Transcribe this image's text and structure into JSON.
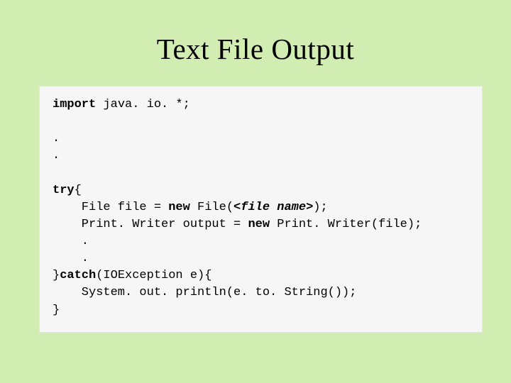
{
  "title": "Text File Output",
  "code": {
    "l1_a": "import",
    "l1_b": " java. io. *;",
    "d1": ".",
    "d2": ".",
    "try_kw": "try",
    "try_brace": "{",
    "l_file_a": "File file = ",
    "l_file_new": "new",
    "l_file_b": " File(",
    "l_file_arg": "<file name>",
    "l_file_c": ");",
    "l_pw_a": "Print. Writer output = ",
    "l_pw_new": "new",
    "l_pw_b": " Print. Writer(file);",
    "d3": ".",
    "d4": ".",
    "catch_close": "}",
    "catch_kw": "catch",
    "catch_paren": "(IOException e){",
    "l_sys": "System. out. println(e. to. String());",
    "end_brace": "}"
  }
}
